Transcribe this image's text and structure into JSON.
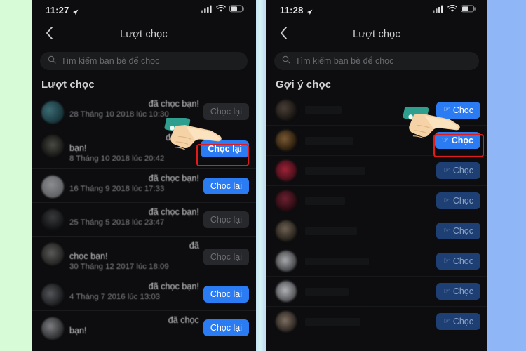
{
  "background": {
    "left_color": "#d6fbd6",
    "right_color": "#8fb6f6"
  },
  "accent": {
    "primary_button": "#2b7bf3",
    "disabled_button": "#27282b",
    "dim_button": "#1d3f74",
    "highlight_border": "#e01b1b",
    "panel_bg": "#0d0d0f"
  },
  "left_phone": {
    "status_bar": {
      "time": "11:27",
      "location_icon": "location-arrow-icon",
      "signal_icon": "cellular-signal-icon",
      "wifi_icon": "wifi-icon",
      "battery_icon": "battery-icon"
    },
    "nav": {
      "back_icon": "chevron-left-icon",
      "title": "Lượt chọc"
    },
    "search": {
      "icon": "search-icon",
      "placeholder": "Tìm kiếm bạn bè để chọc",
      "value": ""
    },
    "section_title": "Lượt chọc",
    "rows": [
      {
        "line1": "đã chọc bạn!",
        "line2": "",
        "time": "28 Tháng 10 2018 lúc 10:30",
        "button": "Chọc lại",
        "state": "off"
      },
      {
        "line1": "đã chọc",
        "line2": "bạn!",
        "time": "8 Tháng 10 2018 lúc 20:42",
        "button": "Chọc lại",
        "state": "bright"
      },
      {
        "line1": "đã chọc bạn!",
        "line2": "",
        "time": "16 Tháng 9 2018 lúc 17:33",
        "button": "Chọc lại",
        "state": "on"
      },
      {
        "line1": "đã chọc bạn!",
        "line2": "",
        "time": "25 Tháng 5 2018 lúc 23:47",
        "button": "Chọc lại",
        "state": "off"
      },
      {
        "line1": "đã",
        "line2": "chọc bạn!",
        "time": "30 Tháng 12 2017 lúc 18:09",
        "button": "Chọc lại",
        "state": "off"
      },
      {
        "line1": "đã chọc bạn!",
        "line2": "",
        "time": "4 Tháng 7 2016 lúc 13:03",
        "button": "Chọc lại",
        "state": "on"
      },
      {
        "line1": "đã chọc",
        "line2": "bạn!",
        "time": "",
        "button": "Chọc lại",
        "state": "on"
      }
    ],
    "highlighted_row_index": 1,
    "hand_cursor": "pointing-hand-cursor"
  },
  "right_phone": {
    "status_bar": {
      "time": "11:28",
      "location_icon": "location-arrow-icon",
      "signal_icon": "cellular-signal-icon",
      "wifi_icon": "wifi-icon",
      "battery_icon": "battery-icon"
    },
    "nav": {
      "back_icon": "chevron-left-icon",
      "title": "Lượt chọc"
    },
    "search": {
      "icon": "search-icon",
      "placeholder": "Tìm kiếm bạn bè để chọc",
      "value": ""
    },
    "section_title": "Gợi ý chọc",
    "button_label": "Chọc",
    "button_icon": "pointing-hand-glyph",
    "rows": [
      {
        "button": "Chọc",
        "state": "on"
      },
      {
        "button": "Chọc",
        "state": "bright"
      },
      {
        "button": "Chọc",
        "state": "dim"
      },
      {
        "button": "Chọc",
        "state": "dim"
      },
      {
        "button": "Chọc",
        "state": "dim"
      },
      {
        "button": "Chọc",
        "state": "dim"
      },
      {
        "button": "Chọc",
        "state": "dim"
      },
      {
        "button": "Chọc",
        "state": "dim"
      }
    ],
    "highlighted_row_index": 1,
    "hand_cursor": "pointing-hand-cursor"
  }
}
